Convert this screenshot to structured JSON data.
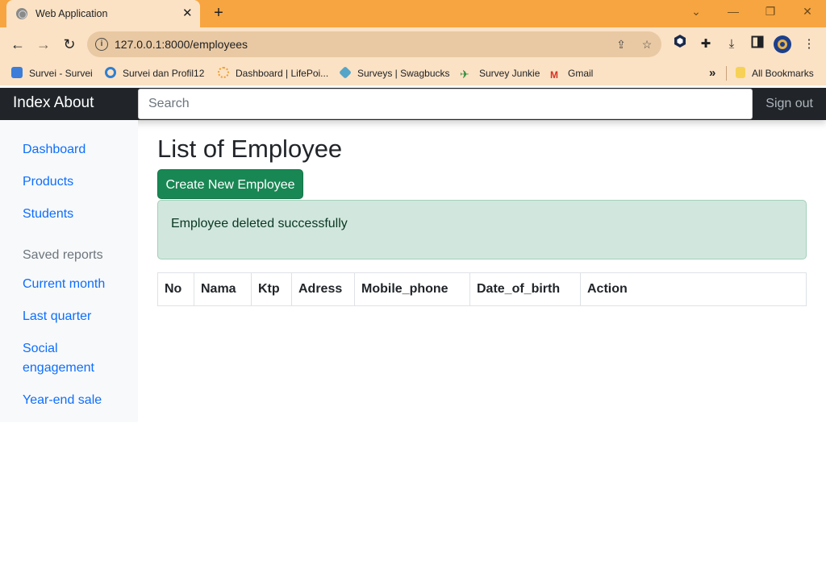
{
  "browser": {
    "tab_title": "Web Application",
    "tab_close": "✕",
    "new_tab": "+",
    "url": "127.0.0.1:8000/employees",
    "window_controls": [
      "⌄",
      "—",
      "❐",
      "✕"
    ],
    "bookmarks": [
      {
        "label": "Survei - Survei",
        "icon": "asterisk-icon",
        "color": "#3b7dd8"
      },
      {
        "label": "Survei dan Profil12",
        "icon": "circle-o-icon",
        "color": "#2f7fd1"
      },
      {
        "label": "Dashboard | LifePoi...",
        "icon": "sun-icon",
        "color": "#f0a030"
      },
      {
        "label": "Surveys | Swagbucks",
        "icon": "diamond-icon",
        "color": "#55a5c8"
      },
      {
        "label": "Survey Junkie",
        "icon": "plane-icon",
        "color": "#2e8b3a"
      },
      {
        "label": "Gmail",
        "icon": "gmail-icon",
        "color": "#d93025"
      }
    ],
    "bookmarks_overflow": "»",
    "all_bookmarks": "All Bookmarks"
  },
  "navbar": {
    "brand": "Index About",
    "search_placeholder": "Search",
    "signout": "Sign out"
  },
  "sidebar": {
    "items": [
      "Dashboard",
      "Products",
      "Students"
    ],
    "saved_heading": "Saved reports",
    "reports": [
      "Current month",
      "Last quarter",
      "Social engagement",
      "Year-end sale"
    ]
  },
  "main": {
    "title": "List of Employee",
    "create_button": "Create New Employee",
    "alert": "Employee deleted successfully",
    "columns": [
      "No",
      "Nama",
      "Ktp",
      "Adress",
      "Mobile_phone",
      "Date_of_birth",
      "Action"
    ]
  },
  "colors": {
    "navbar_bg": "#212529",
    "primary_link": "#0d6efd",
    "success_button": "#198754",
    "alert_bg": "#d1e7dd",
    "tabstrip": "#f7a540"
  }
}
